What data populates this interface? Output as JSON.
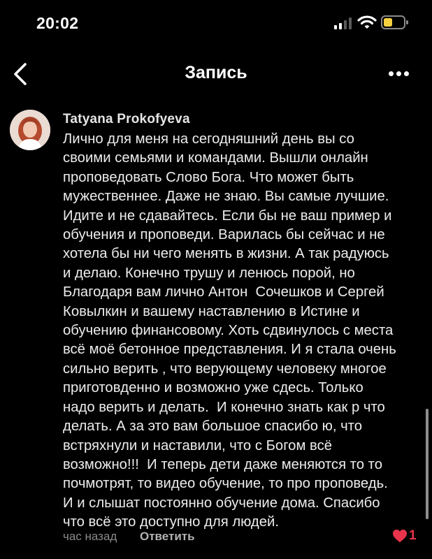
{
  "status_bar": {
    "time": "20:02",
    "battery_color": "#f4d03f"
  },
  "nav": {
    "title": "Запись"
  },
  "comment": {
    "author": "Tatyana Prokofyeva",
    "text_lines": [
      "Лично для меня на сегодняшний день вы со",
      "своими семьями и командами. Вышли онлайн",
      "проповедовать Слово Бога. Что может быть",
      "мужественнее. Даже не знаю. Вы самые лучшие.",
      "Идите и не сдавайтесь. Если бы не ваш пример и",
      "обучения и проповеди. Варилась бы сейчас и не",
      "хотела бы ни чего менять в жизни. А так радуюсь",
      "и делаю. Конечно трушу и ленюсь порой, но",
      "Благодаря вам лично Антон  Сочешков и Сергей",
      "Ковылкин и вашему наставлению в Истине и",
      "обучению финансовому. Хоть сдвинулось с места",
      "всё моё бетонное представления. И я стала очень",
      "сильно верить , что верующему человеку многое",
      "приготовденно и возможно уже сдесь. Только",
      "надо верить и делать.  И конечно знать как р что",
      "делать. А за это вам большое спасибо ю, что",
      "встряхнули и наставили, что с Богом всё",
      "возможно!!!  И теперь дети даже меняются то то",
      "почмотрят, то видео обучение, то про проповедь.",
      "И и слышат постоянно обучение дома. Спасибо",
      "что всё это доступно для людей."
    ],
    "time_ago": "час назад",
    "reply_label": "Ответить",
    "like_count": "1",
    "like_color": "#e8344a"
  }
}
